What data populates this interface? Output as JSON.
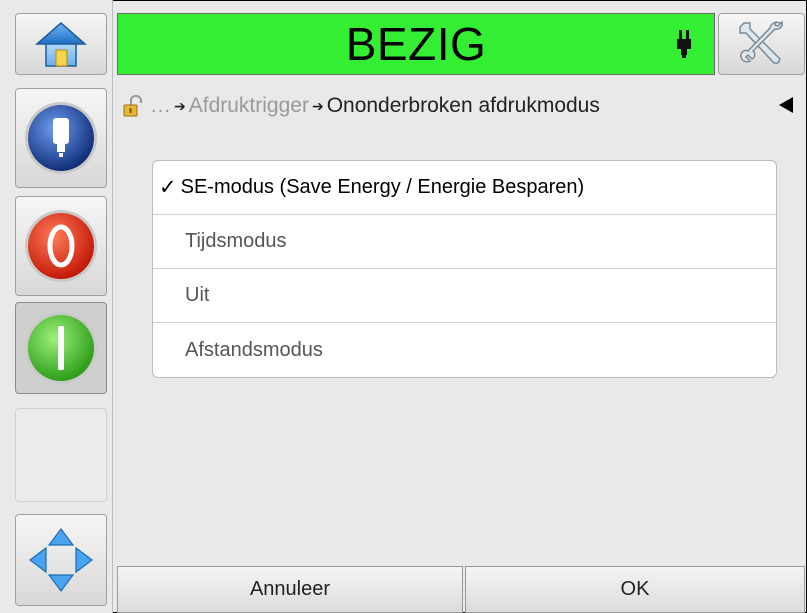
{
  "header": {
    "status": "BEZIG",
    "status_color": "#33ee33",
    "home_icon": "home-icon",
    "tools_icon": "tools-icon",
    "status_icon": "printhead-icon"
  },
  "breadcrumb": {
    "ellipsis": "…",
    "parent": "Afdruktrigger",
    "current": "Ononderbroken afdrukmodus",
    "separator": "➔"
  },
  "sidebar": {
    "items": [
      {
        "icon": "ink-cartridge-icon"
      },
      {
        "icon": "stop-icon"
      },
      {
        "icon": "start-icon"
      },
      {
        "icon": ""
      },
      {
        "icon": "navigation-arrows-icon"
      }
    ]
  },
  "options": {
    "checkmark": "✓",
    "items": [
      {
        "label": "SE-modus (Save Energy / Energie Besparen)",
        "selected": true
      },
      {
        "label": "Tijdsmodus",
        "selected": false
      },
      {
        "label": "Uit",
        "selected": false
      },
      {
        "label": "Afstandsmodus",
        "selected": false
      }
    ]
  },
  "footer": {
    "cancel": "Annuleer",
    "ok": "OK"
  }
}
